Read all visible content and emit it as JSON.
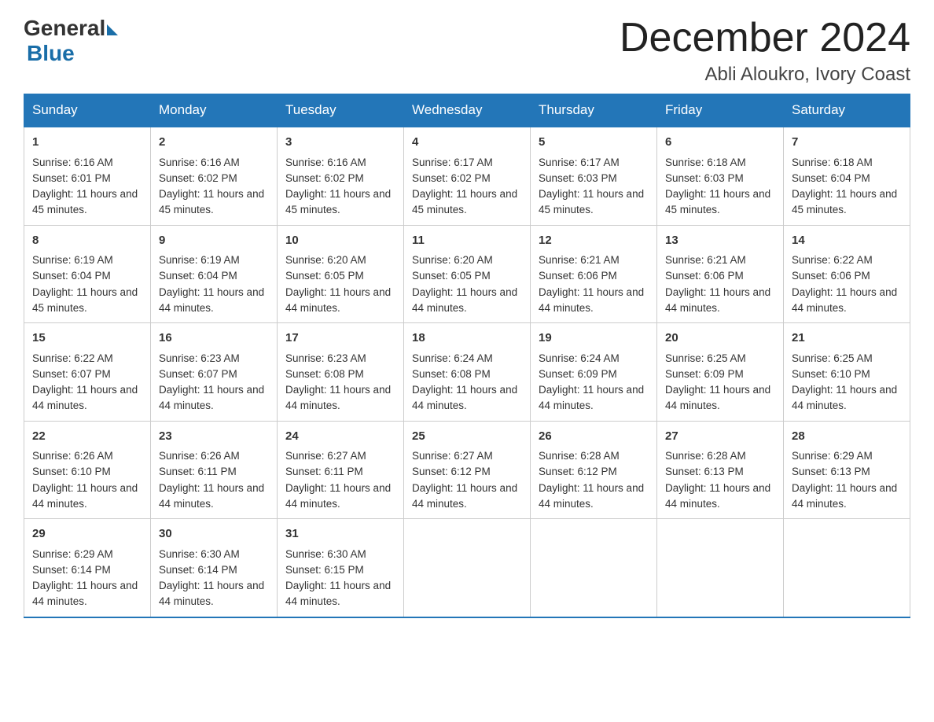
{
  "logo": {
    "general": "General",
    "blue": "Blue"
  },
  "title": {
    "month_year": "December 2024",
    "location": "Abli Aloukro, Ivory Coast"
  },
  "headers": [
    "Sunday",
    "Monday",
    "Tuesday",
    "Wednesday",
    "Thursday",
    "Friday",
    "Saturday"
  ],
  "weeks": [
    [
      {
        "day": "1",
        "sunrise": "6:16 AM",
        "sunset": "6:01 PM",
        "daylight": "11 hours and 45 minutes."
      },
      {
        "day": "2",
        "sunrise": "6:16 AM",
        "sunset": "6:02 PM",
        "daylight": "11 hours and 45 minutes."
      },
      {
        "day": "3",
        "sunrise": "6:16 AM",
        "sunset": "6:02 PM",
        "daylight": "11 hours and 45 minutes."
      },
      {
        "day": "4",
        "sunrise": "6:17 AM",
        "sunset": "6:02 PM",
        "daylight": "11 hours and 45 minutes."
      },
      {
        "day": "5",
        "sunrise": "6:17 AM",
        "sunset": "6:03 PM",
        "daylight": "11 hours and 45 minutes."
      },
      {
        "day": "6",
        "sunrise": "6:18 AM",
        "sunset": "6:03 PM",
        "daylight": "11 hours and 45 minutes."
      },
      {
        "day": "7",
        "sunrise": "6:18 AM",
        "sunset": "6:04 PM",
        "daylight": "11 hours and 45 minutes."
      }
    ],
    [
      {
        "day": "8",
        "sunrise": "6:19 AM",
        "sunset": "6:04 PM",
        "daylight": "11 hours and 45 minutes."
      },
      {
        "day": "9",
        "sunrise": "6:19 AM",
        "sunset": "6:04 PM",
        "daylight": "11 hours and 44 minutes."
      },
      {
        "day": "10",
        "sunrise": "6:20 AM",
        "sunset": "6:05 PM",
        "daylight": "11 hours and 44 minutes."
      },
      {
        "day": "11",
        "sunrise": "6:20 AM",
        "sunset": "6:05 PM",
        "daylight": "11 hours and 44 minutes."
      },
      {
        "day": "12",
        "sunrise": "6:21 AM",
        "sunset": "6:06 PM",
        "daylight": "11 hours and 44 minutes."
      },
      {
        "day": "13",
        "sunrise": "6:21 AM",
        "sunset": "6:06 PM",
        "daylight": "11 hours and 44 minutes."
      },
      {
        "day": "14",
        "sunrise": "6:22 AM",
        "sunset": "6:06 PM",
        "daylight": "11 hours and 44 minutes."
      }
    ],
    [
      {
        "day": "15",
        "sunrise": "6:22 AM",
        "sunset": "6:07 PM",
        "daylight": "11 hours and 44 minutes."
      },
      {
        "day": "16",
        "sunrise": "6:23 AM",
        "sunset": "6:07 PM",
        "daylight": "11 hours and 44 minutes."
      },
      {
        "day": "17",
        "sunrise": "6:23 AM",
        "sunset": "6:08 PM",
        "daylight": "11 hours and 44 minutes."
      },
      {
        "day": "18",
        "sunrise": "6:24 AM",
        "sunset": "6:08 PM",
        "daylight": "11 hours and 44 minutes."
      },
      {
        "day": "19",
        "sunrise": "6:24 AM",
        "sunset": "6:09 PM",
        "daylight": "11 hours and 44 minutes."
      },
      {
        "day": "20",
        "sunrise": "6:25 AM",
        "sunset": "6:09 PM",
        "daylight": "11 hours and 44 minutes."
      },
      {
        "day": "21",
        "sunrise": "6:25 AM",
        "sunset": "6:10 PM",
        "daylight": "11 hours and 44 minutes."
      }
    ],
    [
      {
        "day": "22",
        "sunrise": "6:26 AM",
        "sunset": "6:10 PM",
        "daylight": "11 hours and 44 minutes."
      },
      {
        "day": "23",
        "sunrise": "6:26 AM",
        "sunset": "6:11 PM",
        "daylight": "11 hours and 44 minutes."
      },
      {
        "day": "24",
        "sunrise": "6:27 AM",
        "sunset": "6:11 PM",
        "daylight": "11 hours and 44 minutes."
      },
      {
        "day": "25",
        "sunrise": "6:27 AM",
        "sunset": "6:12 PM",
        "daylight": "11 hours and 44 minutes."
      },
      {
        "day": "26",
        "sunrise": "6:28 AM",
        "sunset": "6:12 PM",
        "daylight": "11 hours and 44 minutes."
      },
      {
        "day": "27",
        "sunrise": "6:28 AM",
        "sunset": "6:13 PM",
        "daylight": "11 hours and 44 minutes."
      },
      {
        "day": "28",
        "sunrise": "6:29 AM",
        "sunset": "6:13 PM",
        "daylight": "11 hours and 44 minutes."
      }
    ],
    [
      {
        "day": "29",
        "sunrise": "6:29 AM",
        "sunset": "6:14 PM",
        "daylight": "11 hours and 44 minutes."
      },
      {
        "day": "30",
        "sunrise": "6:30 AM",
        "sunset": "6:14 PM",
        "daylight": "11 hours and 44 minutes."
      },
      {
        "day": "31",
        "sunrise": "6:30 AM",
        "sunset": "6:15 PM",
        "daylight": "11 hours and 44 minutes."
      },
      null,
      null,
      null,
      null
    ]
  ]
}
